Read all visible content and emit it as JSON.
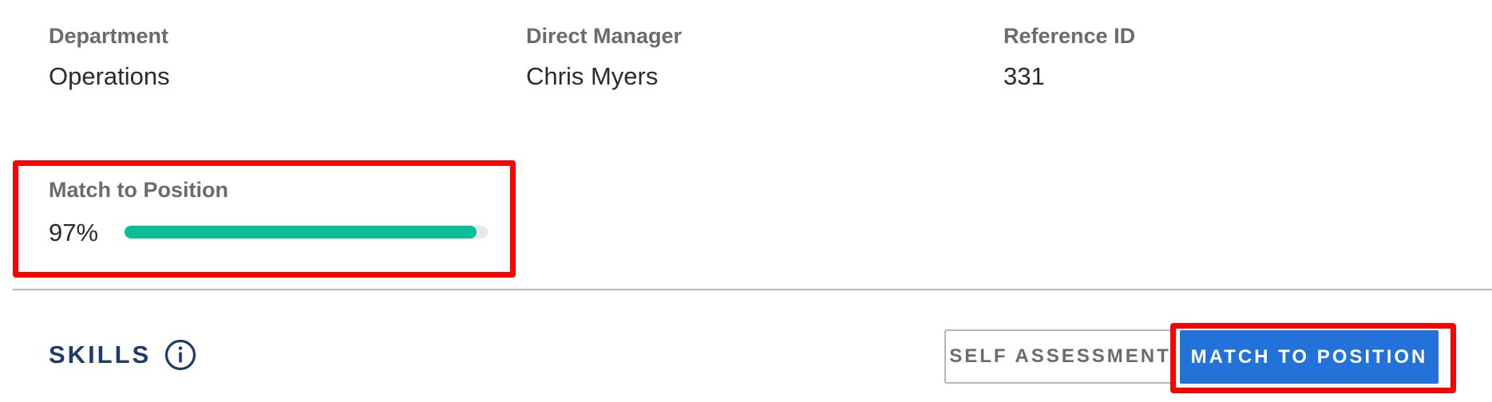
{
  "details": {
    "department": {
      "label": "Department",
      "value": "Operations"
    },
    "direct_manager": {
      "label": "Direct Manager",
      "value": "Chris Myers"
    },
    "reference_id": {
      "label": "Reference ID",
      "value": "331"
    }
  },
  "match": {
    "label": "Match to Position",
    "percent_text": "97%",
    "percent": 97,
    "fill_color": "#08bf96",
    "track_color": "#e7e8ee",
    "highlight_color": "#ff0000"
  },
  "skills": {
    "title": "SKILLS",
    "info_icon": "info-circle-icon",
    "title_color": "#1d3c6e"
  },
  "buttons": {
    "self_assessment": "SELF ASSESSMENT",
    "match_to_position": "MATCH TO POSITION",
    "match_button_color": "#2272d9"
  }
}
